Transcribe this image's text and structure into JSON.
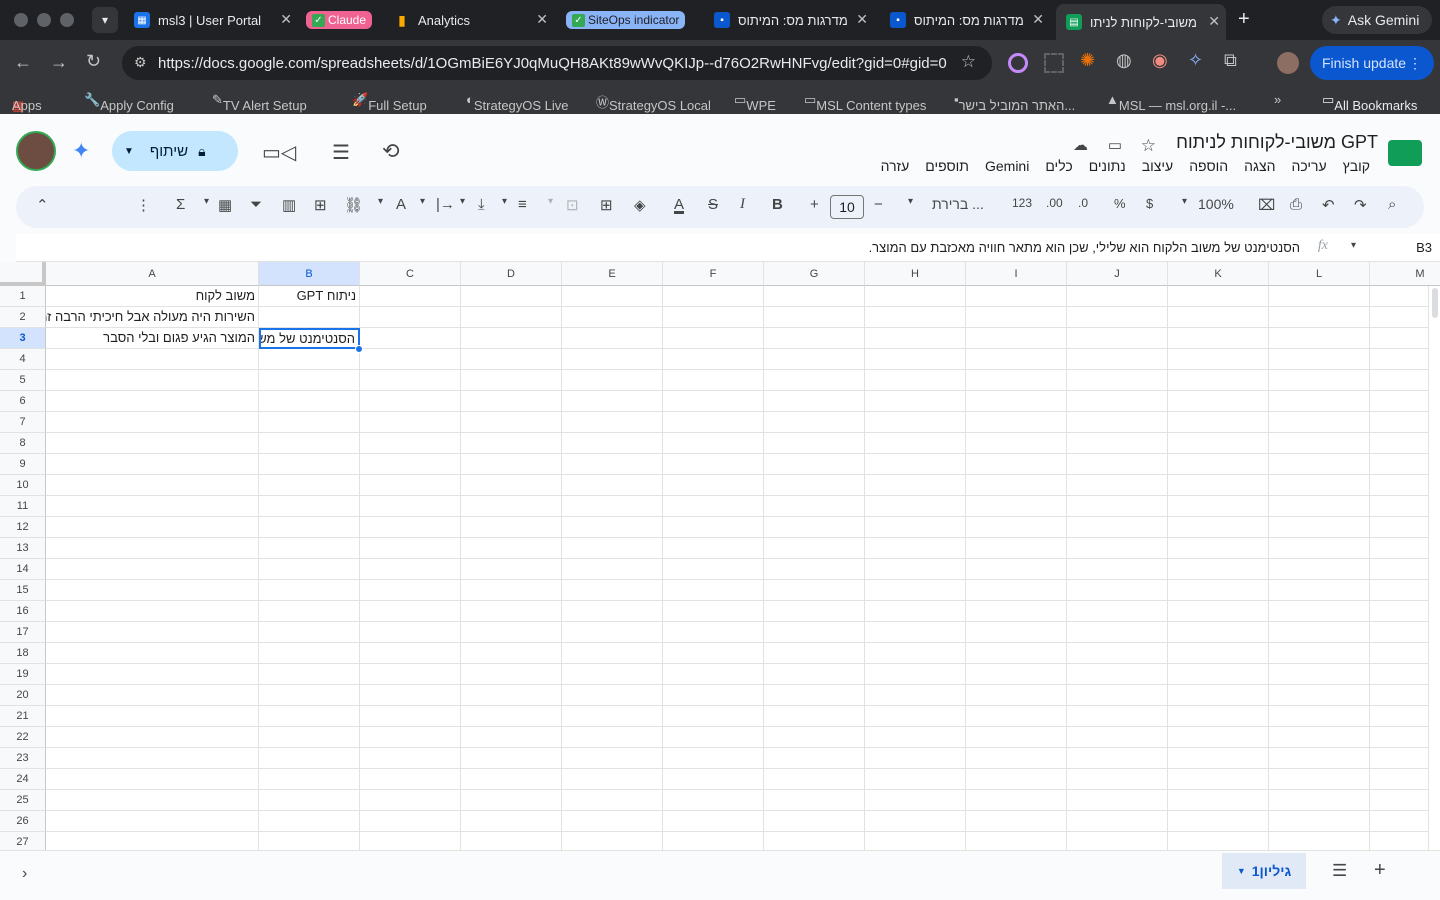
{
  "browser": {
    "tabs": [
      {
        "label": "msl3 | User Portal",
        "color": "#1a73e8"
      },
      {
        "label": "Claude",
        "color": "#f06292"
      },
      {
        "label": "Analytics",
        "color": "#f9ab00"
      },
      {
        "label": "SiteOps indicator",
        "color": "#8ab4f8"
      },
      {
        "label": "מדרגות מס: המיתוס",
        "color": "#202124"
      },
      {
        "label": "מדרגות מס: המיתוס",
        "color": "#202124"
      },
      {
        "label": "משובי-לקוחות לניתו",
        "color": "#0f9d58"
      }
    ],
    "ask_gemini": "Ask Gemini",
    "url": "https://docs.google.com/spreadsheets/d/1OGmBiE6YJ0qMuQH8AKt89wWvQKIJp--d76O2RwHNFvg/edit?gid=0#gid=0",
    "finish_update": "Finish update",
    "bookmarks": [
      "Apps",
      "Apply Config",
      "TV Alert Setup",
      "Full Setup",
      "StrategyOS Live",
      "StrategyOS Local",
      "WPE",
      "MSL Content types",
      "האתר המוביל בישר...",
      "MSL — msl.org.il -...",
      "All Bookmarks"
    ]
  },
  "sheet": {
    "title": "משובי-לקוחות לניתוח GPT",
    "menu": [
      "קובץ",
      "עריכה",
      "הצגה",
      "הוספה",
      "עיצוב",
      "נתונים",
      "כלים",
      "Gemini",
      "תוספים",
      "עזרה"
    ],
    "share_label": "שיתוף",
    "toolbar": {
      "zoom": "100%",
      "currency": "$",
      "percent": "%",
      "format123": "123",
      "font": "ברירת ...",
      "font_size": "10"
    },
    "name_box": "B3",
    "formula": "הסנטימנט של משוב הלקוח הוא שלילי, שכן הוא מתאר חוויה מאכזבת עם המוצר.",
    "columns": [
      "M",
      "L",
      "K",
      "J",
      "I",
      "H",
      "G",
      "F",
      "E",
      "D",
      "C",
      "B",
      "A"
    ],
    "rows": [
      "1",
      "2",
      "3",
      "4",
      "5",
      "6",
      "7",
      "8",
      "9",
      "10",
      "11",
      "12",
      "13",
      "14",
      "15",
      "16",
      "17",
      "18",
      "19",
      "20",
      "21",
      "22",
      "23",
      "24",
      "25",
      "26",
      "27"
    ],
    "cells": {
      "A1": "משוב לקוח",
      "B1": "ניתוח GPT",
      "A2": "השירות היה מעולה אבל חיכיתי הרבה זמן",
      "A3": "המוצר הגיע פגום ובלי הסבר",
      "B3": "הסנטימנט של משוב הלקוח הוא שלילי"
    },
    "sheet_tab": "גיליון1"
  }
}
